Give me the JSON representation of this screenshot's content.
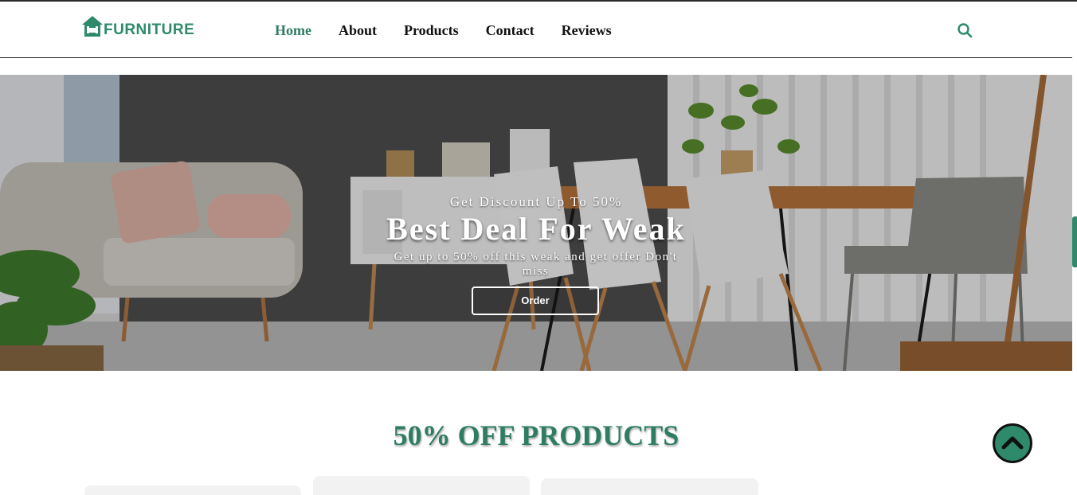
{
  "header": {
    "logo_text": "FURNITURE",
    "nav": [
      {
        "label": "Home",
        "active": true
      },
      {
        "label": "About",
        "active": false
      },
      {
        "label": "Products",
        "active": false
      },
      {
        "label": "Contact",
        "active": false
      },
      {
        "label": "Reviews",
        "active": false
      }
    ],
    "search_icon": "search-icon"
  },
  "hero": {
    "subtitle": "Get Discount Up To 50%",
    "title": "Best Deal For Weak",
    "description": "Get up to 50% off this weak and get offer Don't miss",
    "button_label": "Order"
  },
  "section": {
    "title": "50% OFF PRODUCTS"
  },
  "colors": {
    "brand_green": "#2e8a6a",
    "active_nav": "#2e7d62",
    "card_bg": "#f2f2f2"
  },
  "icons": [
    "home-logo-icon",
    "search-icon",
    "chevron-up-icon"
  ]
}
